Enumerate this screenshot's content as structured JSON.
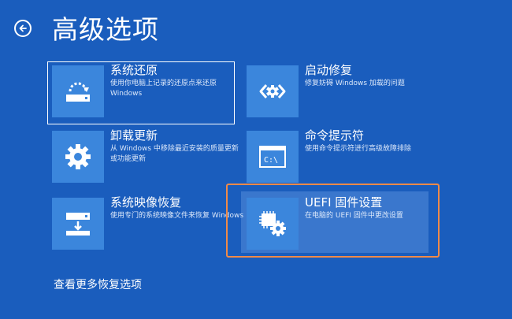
{
  "header": {
    "back_icon": "back-arrow-icon",
    "title": "高级选项"
  },
  "options": [
    {
      "name": "系统还原",
      "desc": "使用你电脑上记录的还原点来还原 Windows",
      "icon": "system-restore-icon"
    },
    {
      "name": "卸载更新",
      "desc": "从 Windows 中移除最近安装的质量更新或功能更新",
      "icon": "gear-icon"
    },
    {
      "name": "系统映像恢复",
      "desc": "使用专门的系统映像文件来恢复 Windows",
      "icon": "image-recovery-icon"
    },
    {
      "name": "启动修复",
      "desc": "修复妨碍 Windows 加载的问题",
      "icon": "startup-repair-icon"
    },
    {
      "name": "命令提示符",
      "desc": "使用命令提示符进行高级故障排除",
      "icon": "command-prompt-icon"
    },
    {
      "name": "UEFI 固件设置",
      "desc": "在电脑的 UEFI 固件中更改设置",
      "icon": "firmware-settings-icon"
    }
  ],
  "more_options_link": "查看更多恢复选项",
  "colors": {
    "background": "#1a5dbd",
    "tile": "#3b86dc",
    "highlight_border": "#f08a48"
  }
}
